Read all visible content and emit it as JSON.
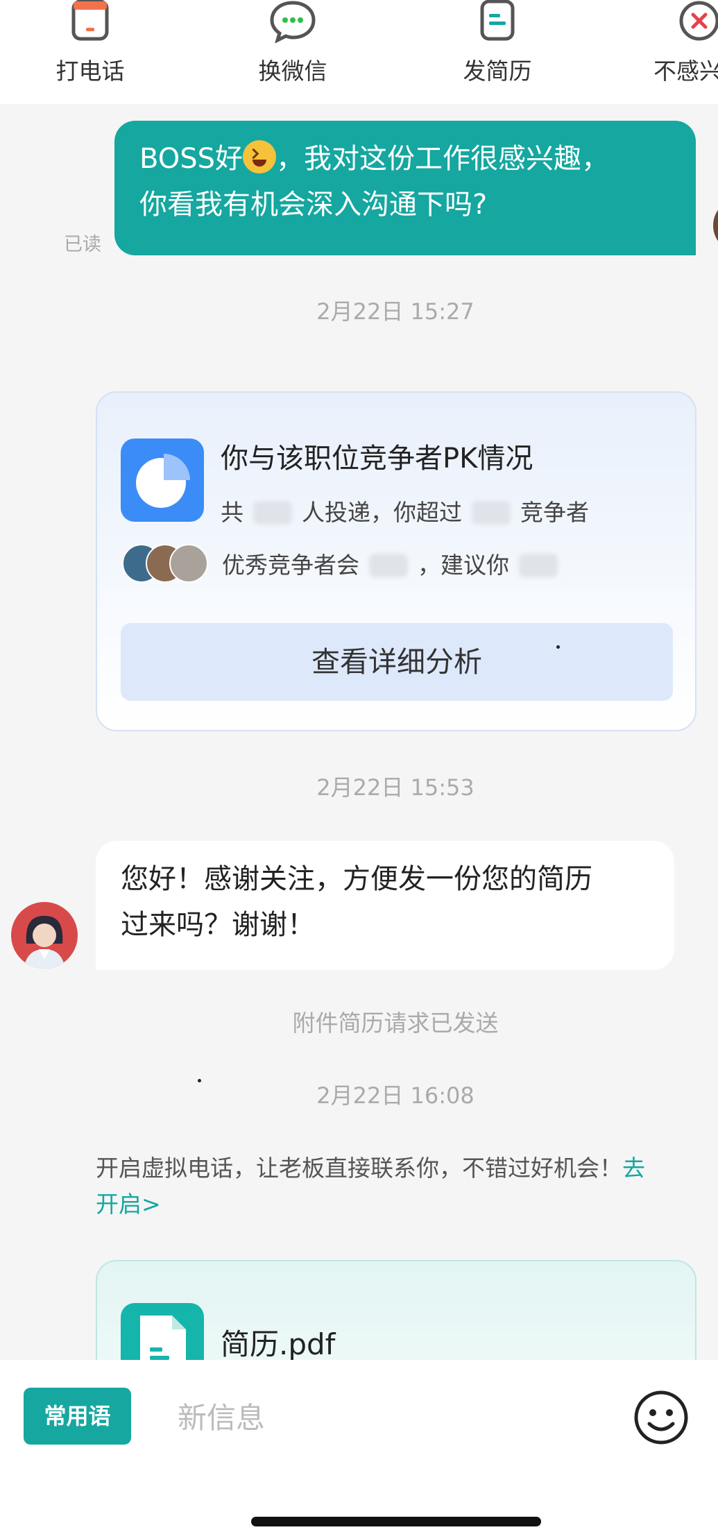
{
  "actions": [
    {
      "label": "打电话",
      "icon": "phone-icon"
    },
    {
      "label": "换微信",
      "icon": "wechat-icon"
    },
    {
      "label": "发简历",
      "icon": "resume-icon"
    },
    {
      "label": "不感兴趣",
      "icon": "not-interested-icon"
    }
  ],
  "messages": {
    "greeting_line1": "BOSS好",
    "greeting_line1_rest": "，我对这份工作很感兴趣，",
    "greeting_line2": "你看我有机会深入沟通下吗?",
    "read_status": "已读",
    "hr_line1": "您好！感谢关注，方便发一份您的简历",
    "hr_line2": "过来吗？谢谢！",
    "attachment_notice": "附件简历请求已发送",
    "tip_text": "开启虚拟电话，让老板直接联系你，不错过好机会！",
    "tip_link_part1": "去",
    "tip_link_part2": "开启>"
  },
  "timestamps": [
    "2月22日 15:27",
    "2月22日 15:53",
    "2月22日 16:08"
  ],
  "pk_card": {
    "title": "你与该职位竞争者PK情况",
    "line1_a": "共",
    "line1_b": "人投递，你超过",
    "line1_c": "竞争者",
    "line2_a": "优秀竞争者会",
    "line2_b": "，建议你",
    "button": "查看详细分析"
  },
  "file_card": {
    "name": "简历.pdf"
  },
  "input": {
    "phrases_button": "常用语",
    "placeholder": "新信息"
  },
  "colors": {
    "accent": "#15a7a0",
    "pk_blue": "#3b8cf7",
    "button_blue": "#dde9fb"
  }
}
